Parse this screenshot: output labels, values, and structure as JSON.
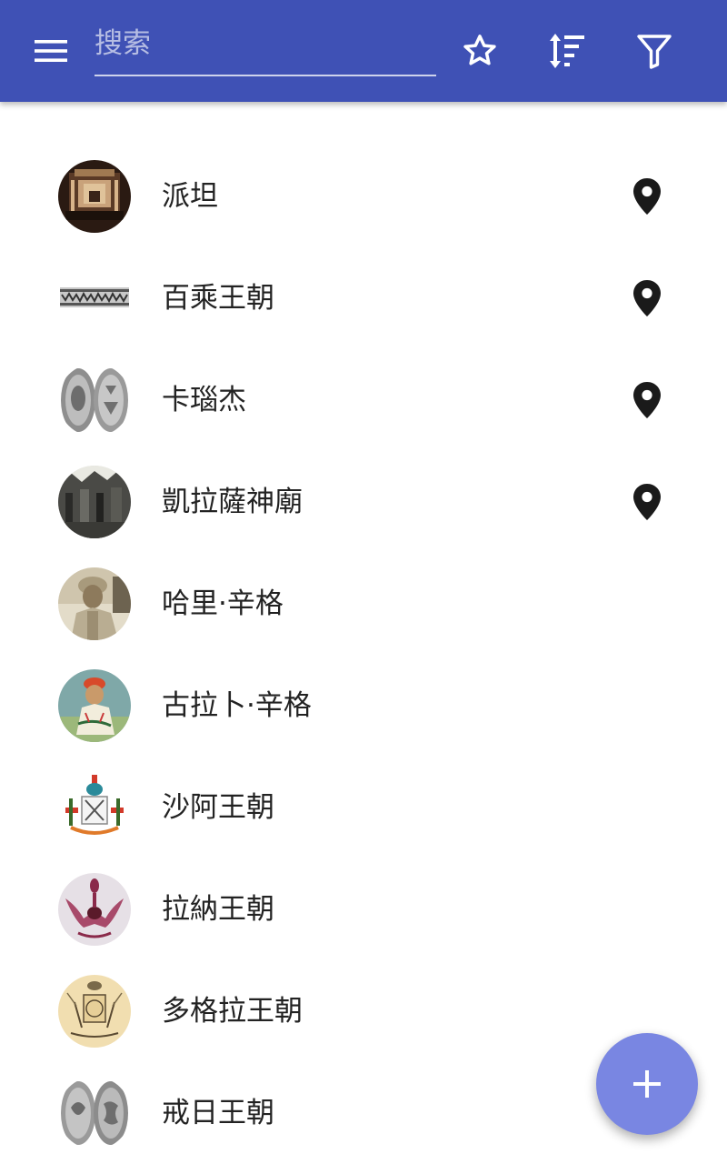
{
  "toolbar": {
    "search_placeholder": "搜索",
    "menu_icon": "menu-icon",
    "favorites_icon": "star-outline-icon",
    "sort_icon": "sort-icon",
    "filter_icon": "filter-icon"
  },
  "colors": {
    "appbar": "#3f51b5",
    "fab": "#7986e2",
    "text": "#222222",
    "pin": "#1a1a1a"
  },
  "list": {
    "items": [
      {
        "title": "派坦",
        "has_location": true,
        "thumbnail": "temple-interior-photo"
      },
      {
        "title": "百乘王朝",
        "has_location": true,
        "thumbnail": "inscription-strip"
      },
      {
        "title": "卡瑙杰",
        "has_location": true,
        "thumbnail": "silver-coins"
      },
      {
        "title": "凱拉薩神廟",
        "has_location": true,
        "thumbnail": "temple-carving-photo"
      },
      {
        "title": "哈里·辛格",
        "has_location": false,
        "thumbnail": "portrait-sepia"
      },
      {
        "title": "古拉卜·辛格",
        "has_location": false,
        "thumbnail": "painted-portrait"
      },
      {
        "title": "沙阿王朝",
        "has_location": false,
        "thumbnail": "royal-emblem"
      },
      {
        "title": "拉納王朝",
        "has_location": false,
        "thumbnail": "crest-emblem"
      },
      {
        "title": "多格拉王朝",
        "has_location": false,
        "thumbnail": "coat-of-arms-engraving"
      },
      {
        "title": "戒日王朝",
        "has_location": false,
        "thumbnail": "silver-coins"
      }
    ]
  },
  "fab": {
    "icon": "add-icon"
  }
}
